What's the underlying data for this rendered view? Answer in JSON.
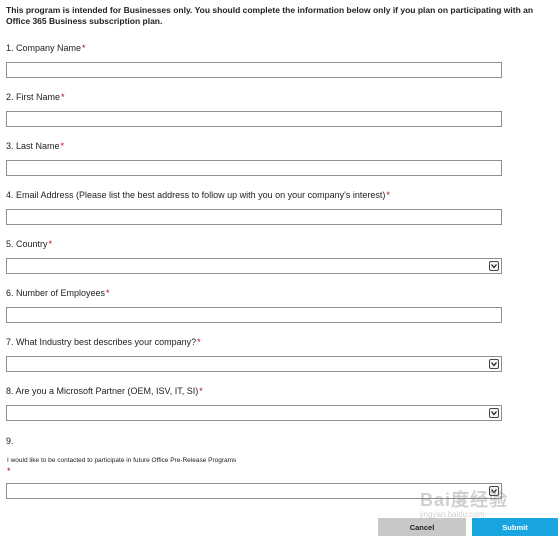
{
  "intro": {
    "part1": "This program is intended for Businesses only.  You should complete the information below ",
    "only": "only",
    "part2": " if you plan on participating with an Office 365 Business subscription plan."
  },
  "required_mark": "*",
  "questions": {
    "q1": {
      "label": "1. Company Name",
      "value": ""
    },
    "q2": {
      "label": "2. First Name",
      "value": ""
    },
    "q3": {
      "label": "3. Last Name",
      "value": ""
    },
    "q4": {
      "label": "4. Email Address (Please list the best address to follow up with you on your company's interest)",
      "value": ""
    },
    "q5": {
      "label": "5. Country",
      "selected": ""
    },
    "q6": {
      "label": "6. Number of Employees",
      "value": ""
    },
    "q7": {
      "label": "7. What Industry best describes your company?",
      "selected": ""
    },
    "q8": {
      "label": "8. Are you a Microsoft Partner (OEM, ISV, IT, SI)",
      "selected": ""
    },
    "q9": {
      "label": "9.",
      "option_text": "I would like to be contacted to participate in future Office Pre-Release Programs",
      "selected": ""
    }
  },
  "buttons": {
    "cancel": "Cancel",
    "submit": "Submit"
  },
  "watermark": {
    "brand": "Bai度经验",
    "url": "jingyan.baidu.com"
  },
  "icons": {
    "dropdown": "chevron-down-icon"
  },
  "colors": {
    "required": "#c00000",
    "submit_bg": "#19a6e0",
    "cancel_bg": "#c8c8c8"
  }
}
